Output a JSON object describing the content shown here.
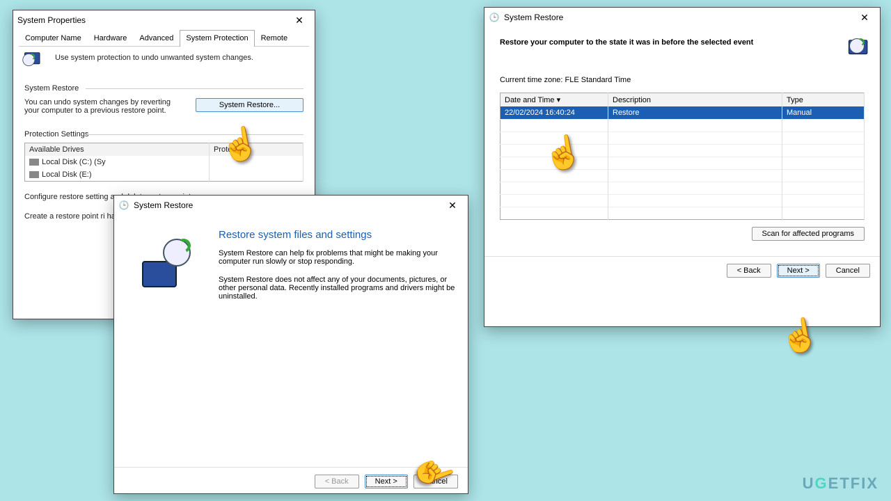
{
  "win1": {
    "title": "System Properties",
    "tabs": [
      "Computer Name",
      "Hardware",
      "Advanced",
      "System Protection",
      "Remote"
    ],
    "intro": "Use system protection to undo unwanted system changes.",
    "grp_restore": "System Restore",
    "restore_desc": "You can undo system changes by reverting your computer to a previous restore point.",
    "restore_btn": "System Restore...",
    "grp_protect": "Protection Settings",
    "col_drives": "Available Drives",
    "col_protection": "Protection",
    "drive1": "Local Disk (C:) (Sy",
    "drive2": "Local Disk (E:)",
    "cfg_text": "Configure restore setting and delete restore point",
    "create_text": "Create a restore point ri have system protection"
  },
  "win2": {
    "title": "System Restore",
    "heading": "Restore system files and settings",
    "p1": "System Restore can help fix problems that might be making your computer run slowly or stop responding.",
    "p2": "System Restore does not affect any of your documents, pictures, or other personal data. Recently installed programs and drivers might be uninstalled.",
    "back": "< Back",
    "next": "Next >",
    "cancel": "Cancel"
  },
  "win3": {
    "title": "System Restore",
    "heading": "Restore your computer to the state it was in before the selected event",
    "tz": "Current time zone: FLE Standard Time",
    "col_date": "Date and Time",
    "col_desc": "Description",
    "col_type": "Type",
    "row_date": "22/02/2024 16:40:24",
    "row_desc": "Restore",
    "row_type": "Manual",
    "scan": "Scan for affected programs",
    "back": "< Back",
    "next": "Next >",
    "cancel": "Cancel"
  },
  "watermark": "UGETFIX"
}
